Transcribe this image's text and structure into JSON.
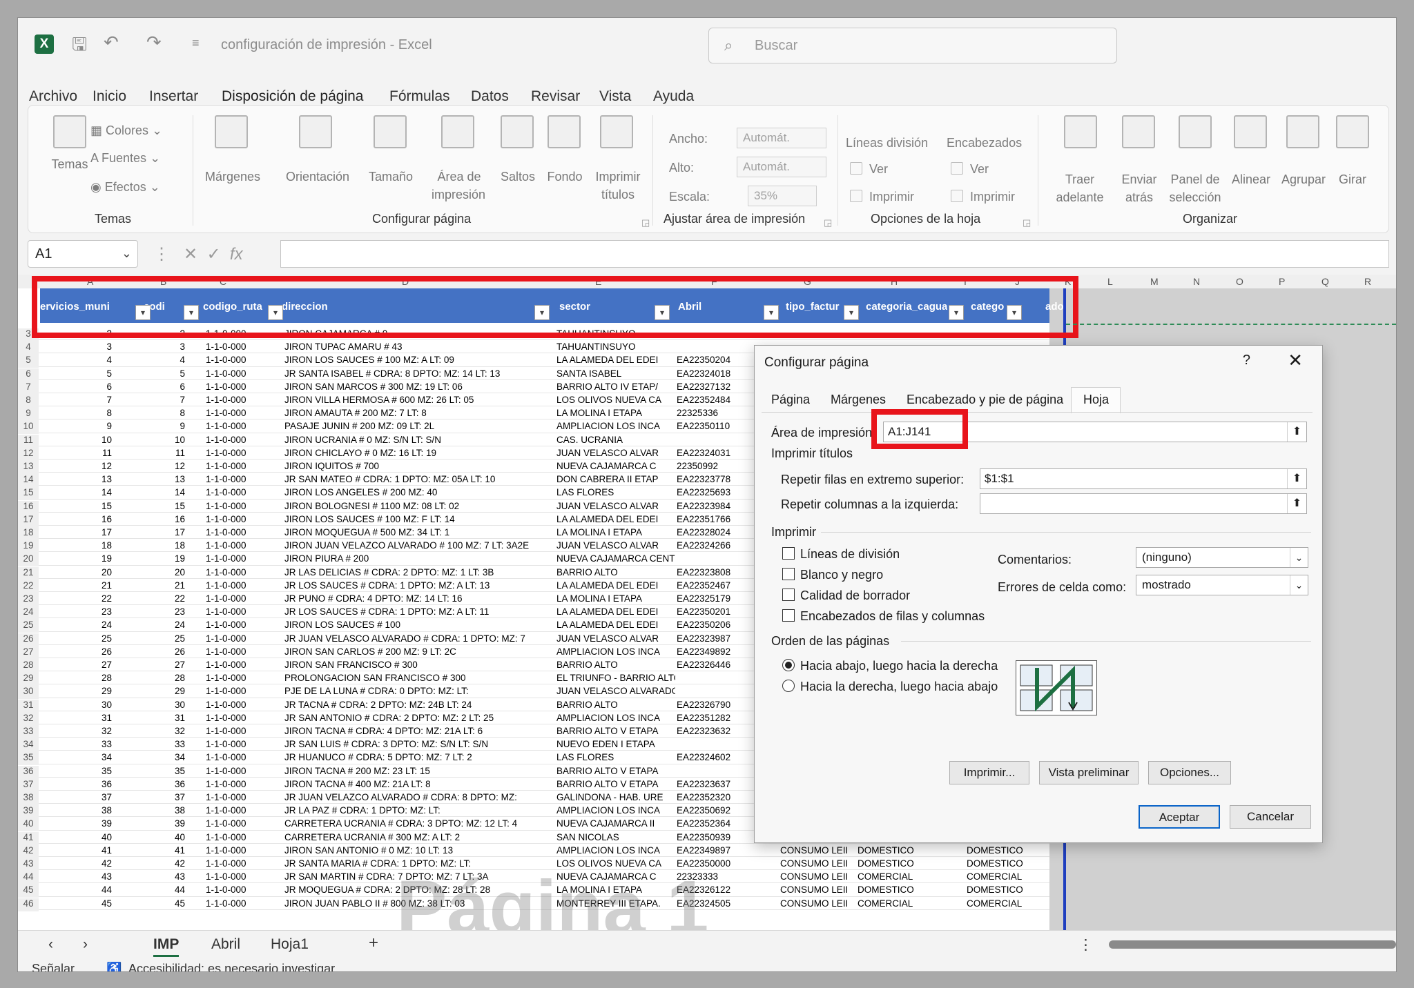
{
  "titlebar": {
    "title": "configuración de impresión  -  Excel",
    "search_placeholder": "Buscar"
  },
  "menu": [
    "Archivo",
    "Inicio",
    "Insertar",
    "Disposición de página",
    "Fórmulas",
    "Datos",
    "Revisar",
    "Vista",
    "Ayuda"
  ],
  "menu_active": "Disposición de página",
  "ribbon": {
    "temas": {
      "label": "Temas",
      "group": "Temas",
      "colores": "Colores",
      "fuentes": "Fuentes",
      "efectos": "Efectos"
    },
    "configurar": {
      "group": "Configurar página",
      "margenes": "Márgenes",
      "orientacion": "Orientación",
      "tamano": "Tamaño",
      "area_1": "Área de",
      "area_2": "impresión",
      "saltos": "Saltos",
      "fondo": "Fondo",
      "imprimir_1": "Imprimir",
      "imprimir_2": "títulos"
    },
    "ajustar": {
      "group": "Ajustar área de impresión",
      "ancho": "Ancho:",
      "ancho_val": "Automát.",
      "alto": "Alto:",
      "alto_val": "Automát.",
      "escala": "Escala:",
      "escala_val": "35%"
    },
    "opciones": {
      "group": "Opciones de la hoja",
      "lineas": "Líneas división",
      "encabezados": "Encabezados",
      "ver": "Ver",
      "imprimir": "Imprimir"
    },
    "organizar": {
      "group": "Organizar",
      "traer_1": "Traer",
      "traer_2": "adelante",
      "enviar_1": "Enviar",
      "enviar_2": "atrás",
      "panel_1": "Panel de",
      "panel_2": "selección",
      "alinear": "Alinear",
      "agrupar": "Agrupar",
      "girar": "Girar"
    }
  },
  "formula": {
    "namebox": "A1",
    "fx": "fx"
  },
  "columns": [
    "A",
    "B",
    "C",
    "D",
    "E",
    "F",
    "G",
    "H",
    "I",
    "J",
    "K",
    "L",
    "M",
    "N",
    "O",
    "P",
    "Q",
    "R"
  ],
  "header_row": [
    "ervicios_muni",
    "codi",
    "codigo_ruta",
    "direccion",
    "sector",
    "Abril",
    "tipo_factur",
    "categoria_cagua",
    "catego",
    "ado"
  ],
  "rows": [
    {
      "n": "3",
      "a": "2",
      "b": "2",
      "c": "1-1-0-000",
      "d": "JIRON CAJAMARCA # 0",
      "e": "TAHUANTINSUYO",
      "f": "",
      "g": "",
      "h": "",
      "i": ""
    },
    {
      "n": "4",
      "a": "3",
      "b": "3",
      "c": "1-1-0-000",
      "d": "JIRON TUPAC AMARU # 43",
      "e": "TAHUANTINSUYO",
      "f": "",
      "g": "",
      "h": "",
      "i": ""
    },
    {
      "n": "5",
      "a": "4",
      "b": "4",
      "c": "1-1-0-000",
      "d": "JIRON LOS SAUCES # 100 MZ: A LT: 09",
      "e": "LA ALAMEDA DEL EDEI",
      "f": "EA22350204",
      "g": "",
      "h": "",
      "i": ""
    },
    {
      "n": "6",
      "a": "5",
      "b": "5",
      "c": "1-1-0-000",
      "d": "JR SANTA ISABEL # CDRA: 8 DPTO: MZ: 14 LT: 13",
      "e": "SANTA ISABEL",
      "f": "EA22324018",
      "g": "",
      "h": "",
      "i": ""
    },
    {
      "n": "7",
      "a": "6",
      "b": "6",
      "c": "1-1-0-000",
      "d": "JIRON SAN MARCOS # 300 MZ: 19 LT: 06",
      "e": "BARRIO ALTO IV ETAP/",
      "f": "EA22327132",
      "g": "",
      "h": "",
      "i": ""
    },
    {
      "n": "8",
      "a": "7",
      "b": "7",
      "c": "1-1-0-000",
      "d": "JIRON VILLA HERMOSA # 600 MZ: 26 LT: 05",
      "e": "LOS OLIVOS NUEVA CA",
      "f": "EA22352484",
      "g": "",
      "h": "",
      "i": ""
    },
    {
      "n": "9",
      "a": "8",
      "b": "8",
      "c": "1-1-0-000",
      "d": "JIRON AMAUTA # 200 MZ: 7 LT: 8",
      "e": "LA MOLINA I ETAPA",
      "f": "22325336",
      "g": "",
      "h": "",
      "i": ""
    },
    {
      "n": "10",
      "a": "9",
      "b": "9",
      "c": "1-1-0-000",
      "d": "PASAJE JUNIN # 200 MZ: 09 LT: 2L",
      "e": "AMPLIACION LOS INCA",
      "f": "EA22350110",
      "g": "",
      "h": "",
      "i": ""
    },
    {
      "n": "11",
      "a": "10",
      "b": "10",
      "c": "1-1-0-000",
      "d": "JIRON UCRANIA # 0 MZ: S/N LT: S/N",
      "e": "CAS. UCRANIA",
      "f": "",
      "g": "",
      "h": "",
      "i": ""
    },
    {
      "n": "12",
      "a": "11",
      "b": "11",
      "c": "1-1-0-000",
      "d": "JIRON CHICLAYO # 0 MZ: 16 LT: 19",
      "e": "JUAN VELASCO ALVAR",
      "f": "EA22324031",
      "g": "",
      "h": "",
      "i": ""
    },
    {
      "n": "13",
      "a": "12",
      "b": "12",
      "c": "1-1-0-000",
      "d": "JIRON IQUITOS # 700",
      "e": "NUEVA CAJAMARCA C",
      "f": "22350992",
      "g": "",
      "h": "",
      "i": ""
    },
    {
      "n": "14",
      "a": "13",
      "b": "13",
      "c": "1-1-0-000",
      "d": "JR SAN MATEO # CDRA: 1 DPTO: MZ: 05A LT: 10",
      "e": "DON CABRERA II ETAP",
      "f": "EA22323778",
      "g": "",
      "h": "",
      "i": ""
    },
    {
      "n": "15",
      "a": "14",
      "b": "14",
      "c": "1-1-0-000",
      "d": "JIRON LOS ANGELES # 200 MZ: 40",
      "e": "LAS FLORES",
      "f": "EA22325693",
      "g": "",
      "h": "",
      "i": ""
    },
    {
      "n": "16",
      "a": "15",
      "b": "15",
      "c": "1-1-0-000",
      "d": "JIRON BOLOGNESI # 1100 MZ: 08 LT: 02",
      "e": "JUAN VELASCO ALVAR",
      "f": "EA22323984",
      "g": "",
      "h": "",
      "i": ""
    },
    {
      "n": "17",
      "a": "16",
      "b": "16",
      "c": "1-1-0-000",
      "d": "JIRON LOS SAUCES # 100 MZ: F LT: 14",
      "e": "LA ALAMEDA DEL EDEI",
      "f": "EA22351766",
      "g": "",
      "h": "",
      "i": ""
    },
    {
      "n": "18",
      "a": "17",
      "b": "17",
      "c": "1-1-0-000",
      "d": "JIRON MOQUEGUA # 500 MZ: 34 LT: 1",
      "e": "LA MOLINA I ETAPA",
      "f": "EA22328024",
      "g": "",
      "h": "",
      "i": ""
    },
    {
      "n": "19",
      "a": "18",
      "b": "18",
      "c": "1-1-0-000",
      "d": "JIRON JUAN VELAZCO ALVARADO # 100 MZ: 7 LT: 3A2E",
      "e": "JUAN VELASCO ALVAR",
      "f": "EA22324266",
      "g": "",
      "h": "",
      "i": ""
    },
    {
      "n": "20",
      "a": "19",
      "b": "19",
      "c": "1-1-0-000",
      "d": "JIRON PIURA # 200",
      "e": "NUEVA CAJAMARCA CENTRO",
      "f": "",
      "g": "",
      "h": "",
      "i": ""
    },
    {
      "n": "21",
      "a": "20",
      "b": "20",
      "c": "1-1-0-000",
      "d": "JR LAS DELICIAS # CDRA: 2 DPTO: MZ: 1 LT: 3B",
      "e": "BARRIO ALTO",
      "f": "EA22323808",
      "g": "",
      "h": "",
      "i": ""
    },
    {
      "n": "22",
      "a": "21",
      "b": "21",
      "c": "1-1-0-000",
      "d": "JR LOS SAUCES # CDRA: 1 DPTO: MZ: A LT: 13",
      "e": "LA ALAMEDA DEL EDEI",
      "f": "EA22352467",
      "g": "",
      "h": "",
      "i": ""
    },
    {
      "n": "23",
      "a": "22",
      "b": "22",
      "c": "1-1-0-000",
      "d": "JR PUNO # CDRA: 4 DPTO: MZ: 14 LT: 16",
      "e": "LA MOLINA I ETAPA",
      "f": "EA22325179",
      "g": "",
      "h": "",
      "i": ""
    },
    {
      "n": "24",
      "a": "23",
      "b": "23",
      "c": "1-1-0-000",
      "d": "JR LOS SAUCES # CDRA: 1 DPTO: MZ: A LT: 11",
      "e": "LA ALAMEDA DEL EDEI",
      "f": "EA22350201",
      "g": "",
      "h": "",
      "i": ""
    },
    {
      "n": "25",
      "a": "24",
      "b": "24",
      "c": "1-1-0-000",
      "d": "JIRON LOS SAUCES # 100",
      "e": "LA ALAMEDA DEL EDEI",
      "f": "EA22350206",
      "g": "",
      "h": "",
      "i": ""
    },
    {
      "n": "26",
      "a": "25",
      "b": "25",
      "c": "1-1-0-000",
      "d": "JR JUAN VELASCO ALVARADO # CDRA: 1 DPTO: MZ: 7",
      "e": "JUAN VELASCO ALVAR",
      "f": "EA22323987",
      "g": "",
      "h": "",
      "i": ""
    },
    {
      "n": "27",
      "a": "26",
      "b": "26",
      "c": "1-1-0-000",
      "d": "JIRON SAN CARLOS # 200 MZ: 9 LT: 2C",
      "e": "AMPLIACION LOS INCA",
      "f": "EA22349892",
      "g": "",
      "h": "",
      "i": ""
    },
    {
      "n": "28",
      "a": "27",
      "b": "27",
      "c": "1-1-0-000",
      "d": "JIRON SAN FRANCISCO # 300",
      "e": "BARRIO ALTO",
      "f": "EA22326446",
      "g": "",
      "h": "",
      "i": ""
    },
    {
      "n": "29",
      "a": "28",
      "b": "28",
      "c": "1-1-0-000",
      "d": "PROLONGACION SAN FRANCISCO # 300",
      "e": "EL TRIUNFO - BARRIO ALTO III ETAPA",
      "f": "",
      "g": "",
      "h": "",
      "i": ""
    },
    {
      "n": "30",
      "a": "29",
      "b": "29",
      "c": "1-1-0-000",
      "d": "PJE DE LA LUNA # CDRA: 0 DPTO: MZ: LT:",
      "e": "JUAN VELASCO ALVARADO II ETAPA",
      "f": "",
      "g": "",
      "h": "",
      "i": ""
    },
    {
      "n": "31",
      "a": "30",
      "b": "30",
      "c": "1-1-0-000",
      "d": "JR TACNA # CDRA: 2 DPTO: MZ: 24B LT: 24",
      "e": "BARRIO ALTO",
      "f": "EA22326790",
      "g": "",
      "h": "",
      "i": ""
    },
    {
      "n": "32",
      "a": "31",
      "b": "31",
      "c": "1-1-0-000",
      "d": "JR SAN ANTONIO # CDRA: 2 DPTO: MZ: 2 LT: 25",
      "e": "AMPLIACION LOS INCA",
      "f": "EA22351282",
      "g": "",
      "h": "",
      "i": ""
    },
    {
      "n": "33",
      "a": "32",
      "b": "32",
      "c": "1-1-0-000",
      "d": "JIRON TACNA # CDRA: 4 DPTO: MZ: 21A LT: 6",
      "e": "BARRIO ALTO V ETAPA",
      "f": "EA22323632",
      "g": "",
      "h": "",
      "i": ""
    },
    {
      "n": "34",
      "a": "33",
      "b": "33",
      "c": "1-1-0-000",
      "d": "JR SAN LUIS # CDRA: 3 DPTO: MZ: S/N LT: S/N",
      "e": "NUEVO EDEN I ETAPA",
      "f": "",
      "g": "",
      "h": "",
      "i": ""
    },
    {
      "n": "35",
      "a": "34",
      "b": "34",
      "c": "1-1-0-000",
      "d": "JR HUANUCO # CDRA: 5 DPTO: MZ: 7 LT: 2",
      "e": "LAS FLORES",
      "f": "EA22324602",
      "g": "",
      "h": "",
      "i": ""
    },
    {
      "n": "36",
      "a": "35",
      "b": "35",
      "c": "1-1-0-000",
      "d": "JIRON TACNA # 200 MZ: 23 LT: 15",
      "e": "BARRIO ALTO V ETAPA",
      "f": "",
      "g": "",
      "h": "",
      "i": ""
    },
    {
      "n": "37",
      "a": "36",
      "b": "36",
      "c": "1-1-0-000",
      "d": "JIRON TACNA # 400 MZ: 21A LT: 8",
      "e": "BARRIO ALTO V ETAPA",
      "f": "EA22323637",
      "g": "",
      "h": "",
      "i": ""
    },
    {
      "n": "38",
      "a": "37",
      "b": "37",
      "c": "1-1-0-000",
      "d": "JR JUAN VELAZCO ALVARADO # CDRA: 8 DPTO: MZ:",
      "e": "GALINDONA - HAB. URE",
      "f": "EA22352320",
      "g": "",
      "h": "",
      "i": ""
    },
    {
      "n": "39",
      "a": "38",
      "b": "38",
      "c": "1-1-0-000",
      "d": "JR LA PAZ # CDRA: 1 DPTO: MZ: LT:",
      "e": "AMPLIACION LOS INCA",
      "f": "EA22350692",
      "g": "",
      "h": "",
      "i": ""
    },
    {
      "n": "40",
      "a": "39",
      "b": "39",
      "c": "1-1-0-000",
      "d": "CARRETERA UCRANIA # CDRA: 3 DPTO: MZ: 12 LT: 4",
      "e": "NUEVA CAJAMARCA II",
      "f": "EA22352364",
      "g": "",
      "h": "",
      "i": ""
    },
    {
      "n": "41",
      "a": "40",
      "b": "40",
      "c": "1-1-0-000",
      "d": "CARRETERA UCRANIA # 300 MZ: A LT: 2",
      "e": "SAN NICOLAS",
      "f": "EA22350939",
      "g": "CONSUMO LEII",
      "h": "COMERCIAL",
      "i": "COMERCIAL"
    },
    {
      "n": "42",
      "a": "41",
      "b": "41",
      "c": "1-1-0-000",
      "d": "JIRON SAN ANTONIO # 0 MZ: 10 LT: 13",
      "e": "AMPLIACION LOS INCA",
      "f": "EA22349897",
      "g": "CONSUMO LEII",
      "h": "DOMESTICO",
      "i": "DOMESTICO"
    },
    {
      "n": "43",
      "a": "42",
      "b": "42",
      "c": "1-1-0-000",
      "d": "JR SANTA MARIA # CDRA: 1 DPTO: MZ: LT:",
      "e": "LOS OLIVOS NUEVA CA",
      "f": "EA22350000",
      "g": "CONSUMO LEII",
      "h": "DOMESTICO",
      "i": "DOMESTICO"
    },
    {
      "n": "44",
      "a": "43",
      "b": "43",
      "c": "1-1-0-000",
      "d": "JR SAN MARTIN # CDRA: 7 DPTO: MZ: 7 LT: 3A",
      "e": "NUEVA CAJAMARCA C",
      "f": "22323333",
      "g": "CONSUMO LEII",
      "h": "COMERCIAL",
      "i": "COMERCIAL"
    },
    {
      "n": "45",
      "a": "44",
      "b": "44",
      "c": "1-1-0-000",
      "d": "JR MOQUEGUA # CDRA: 2 DPTO: MZ: 28 LT: 28",
      "e": "LA MOLINA I ETAPA",
      "f": "EA22326122",
      "g": "CONSUMO LEII",
      "h": "DOMESTICO",
      "i": "DOMESTICO"
    },
    {
      "n": "46",
      "a": "45",
      "b": "45",
      "c": "1-1-0-000",
      "d": "JIRON JUAN PABLO II # 800 MZ: 38 LT: 03",
      "e": "MONTERREY III ETAPA.",
      "f": "EA22324505",
      "g": "CONSUMO LEII",
      "h": "COMERCIAL",
      "i": "COMERCIAL"
    }
  ],
  "watermark": "Página 1",
  "sheet_tabs": [
    "IMP",
    "Abril",
    "Hoja1"
  ],
  "add_sheet": "+",
  "status": {
    "mode": "Señalar",
    "accessibility": "Accesibilidad: es necesario investigar"
  },
  "dialog": {
    "title": "Configurar página",
    "help": "?",
    "close": "✕",
    "tabs": [
      "Página",
      "Márgenes",
      "Encabezado y pie de página",
      "Hoja"
    ],
    "active_tab": "Hoja",
    "print_area_label": "Área de impresión:",
    "print_area_value": "A1:J141",
    "print_titles_label": "Imprimir títulos",
    "repeat_rows_label": "Repetir filas en extremo superior:",
    "repeat_rows_value": "$1:$1",
    "repeat_cols_label": "Repetir columnas a la izquierda:",
    "repeat_cols_value": "",
    "print_section": "Imprimir",
    "checks": [
      "Líneas de división",
      "Blanco y negro",
      "Calidad de borrador",
      "Encabezados de filas y columnas"
    ],
    "comments_label": "Comentarios:",
    "comments_value": "(ninguno)",
    "errors_label": "Errores de celda como:",
    "errors_value": "mostrado",
    "order_section": "Orden de las páginas",
    "order_1": "Hacia abajo, luego hacia la derecha",
    "order_2": "Hacia la derecha, luego hacia abajo",
    "btn_print": "Imprimir...",
    "btn_preview": "Vista preliminar",
    "btn_options": "Opciones...",
    "btn_ok": "Aceptar",
    "btn_cancel": "Cancelar"
  }
}
